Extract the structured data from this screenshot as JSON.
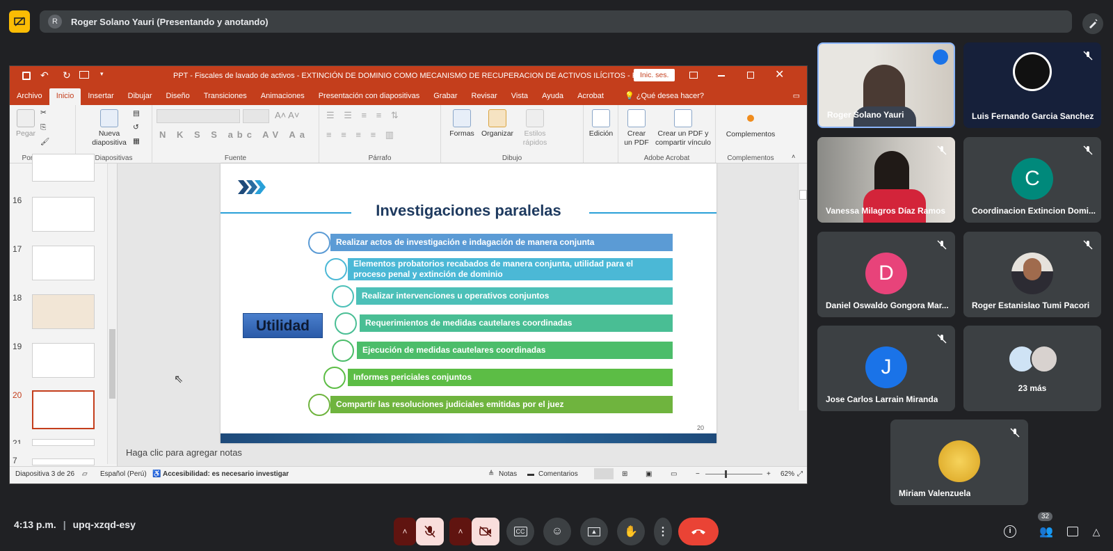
{
  "meet": {
    "presenter_initial": "R",
    "presenter_label": "Roger Solano Yauri (Presentando y anotando)",
    "time": "4:13 p.m.",
    "meeting_code": "upq-xzqd-esy",
    "participants_badge": "32",
    "more_label": "23 más",
    "colors": {
      "present_icon": "#fbbc04",
      "end_call": "#ea4335",
      "muted_btn": "#f9dedc"
    }
  },
  "participants": [
    {
      "name": "Roger Solano Yauri",
      "type": "video",
      "speaking": true
    },
    {
      "name": "Luis Fernando Garcia Sanchez",
      "type": "logo"
    },
    {
      "name": "Vanessa Milagros Díaz Ramos",
      "type": "video"
    },
    {
      "name": "Coordinacion Extincion Domi...",
      "initial": "C",
      "color": "#00897b"
    },
    {
      "name": "Daniel Oswaldo Gongora Mar...",
      "initial": "D",
      "color": "#e8437a"
    },
    {
      "name": "Roger Estanislao Tumi Pacori",
      "type": "photo"
    },
    {
      "name": "Jose Carlos Larrain Miranda",
      "initial": "J",
      "color": "#1a73e8"
    },
    {
      "name": "Miriam Valenzuela",
      "type": "photo"
    }
  ],
  "ppt": {
    "title": "PPT - Fiscales de lavado de activos - EXTINCIÓN DE DOMINIO COMO MECANISMO DE RECUPERACION DE ACTIVOS ILÍCITOS  -  PowerPoint",
    "signin": "Inic. ses.",
    "tabs": [
      "Archivo",
      "Inicio",
      "Insertar",
      "Dibujar",
      "Diseño",
      "Transiciones",
      "Animaciones",
      "Presentación con diapositivas",
      "Grabar",
      "Revisar",
      "Vista",
      "Ayuda",
      "Acrobat"
    ],
    "tell_me": "¿Qué desea hacer?",
    "ribbon": {
      "pegar": "Pegar",
      "portapapeles": "Portapapeles",
      "nueva_1": "Nueva",
      "nueva_2": "diapositiva",
      "diapositivas": "Diapositivas",
      "fuente": "Fuente",
      "parrafo": "Párrafo",
      "formas": "Formas",
      "organizar": "Organizar",
      "estilos_1": "Estilos",
      "estilos_2": "rápidos",
      "dibujo": "Dibujo",
      "edicion": "Edición",
      "crear_pdf_1": "Crear",
      "crear_pdf_2": "un PDF",
      "crear_share_1": "Crear un PDF y",
      "crear_share_2": "compartir vínculo",
      "adobe": "Adobe Acrobat",
      "complementos_btn": "Complementos",
      "complementos": "Complementos"
    },
    "thumb_numbers": [
      "16",
      "17",
      "18",
      "19",
      "20",
      "21",
      "7"
    ],
    "notes_placeholder": "Haga clic para agregar notas",
    "status": {
      "slide": "Diapositiva 3 de 26",
      "lang": "Español (Perú)",
      "access": "Accesibilidad: es necesario investigar",
      "notas": "Notas",
      "comentarios": "Comentarios",
      "zoom": "62%"
    }
  },
  "slide": {
    "title": "Investigaciones paralelas",
    "label": "Utilidad",
    "number": "20",
    "items": [
      "Realizar actos de investigación e indagación de manera conjunta",
      "Elementos probatorios recabados de manera conjunta, utilidad para el proceso penal y extinción de dominio",
      "Realizar intervenciones u operativos conjuntos",
      "Requerimientos de medidas cautelares coordinadas",
      "Ejecución de medidas cautelares coordinadas",
      "Informes periciales conjuntos",
      "Compartir las resoluciones judiciales emitidas por el juez"
    ],
    "item_colors": [
      "#5b9bd5",
      "#4bb8d6",
      "#4cc0b8",
      "#49be94",
      "#4cbd6a",
      "#5cbd45",
      "#6fb43e"
    ]
  }
}
